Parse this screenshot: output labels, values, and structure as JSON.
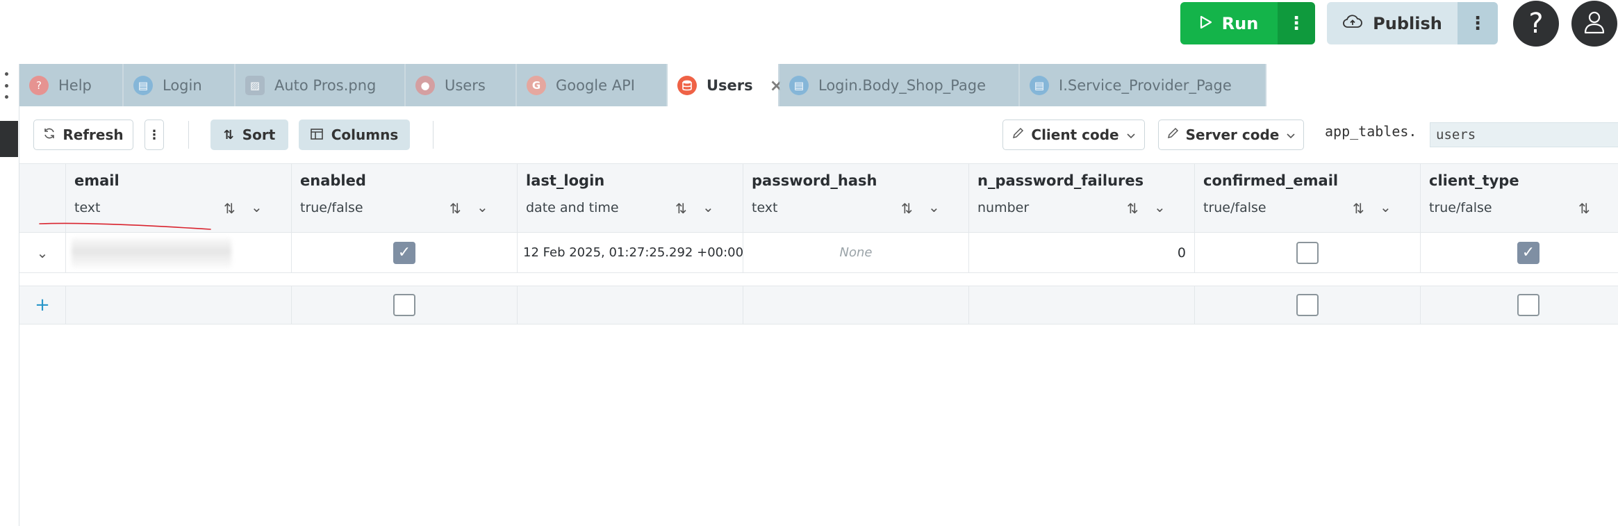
{
  "topbar": {
    "run_label": "Run",
    "publish_label": "Publish",
    "help_label": "?"
  },
  "tabs": [
    {
      "label": "Help",
      "icon": "help-icon",
      "active": false
    },
    {
      "label": "Login",
      "icon": "form-icon",
      "active": false
    },
    {
      "label": "Auto Pros.png",
      "icon": "image-icon",
      "active": false
    },
    {
      "label": "Users",
      "icon": "users-icon",
      "active": false
    },
    {
      "label": "Google API",
      "icon": "google-icon",
      "active": false
    },
    {
      "label": "Users",
      "icon": "database-icon",
      "active": true
    },
    {
      "label": "Login.Body_Shop_Page",
      "icon": "form-icon",
      "active": false
    },
    {
      "label": "I.Service_Provider_Page",
      "icon": "form-icon",
      "active": false
    }
  ],
  "toolbar": {
    "refresh_label": "Refresh",
    "sort_label": "Sort",
    "columns_label": "Columns",
    "client_code_label": "Client code",
    "server_code_label": "Server code",
    "code_prefix": "app_tables.",
    "table_name": "users"
  },
  "columns": [
    {
      "name": "email",
      "type": "text"
    },
    {
      "name": "enabled",
      "type": "true/false"
    },
    {
      "name": "last_login",
      "type": "date and time"
    },
    {
      "name": "password_hash",
      "type": "text"
    },
    {
      "name": "n_password_failures",
      "type": "number"
    },
    {
      "name": "confirmed_email",
      "type": "true/false"
    },
    {
      "name": "client_type",
      "type": "true/false"
    }
  ],
  "rows": [
    {
      "email": "",
      "enabled": true,
      "last_login": "12 Feb 2025, 01:27:25.292 +00:00",
      "password_hash": "None",
      "n_password_failures": "0",
      "confirmed_email": false,
      "client_type": true
    }
  ],
  "new_row": {
    "add_symbol": "+"
  },
  "colors": {
    "run_green": "#14b44a",
    "publish_bg": "#d8e6ec",
    "inactive_tab": "#b6cbd5",
    "checked_box": "#7f8fa3",
    "annotation_red": "#d9232e"
  }
}
